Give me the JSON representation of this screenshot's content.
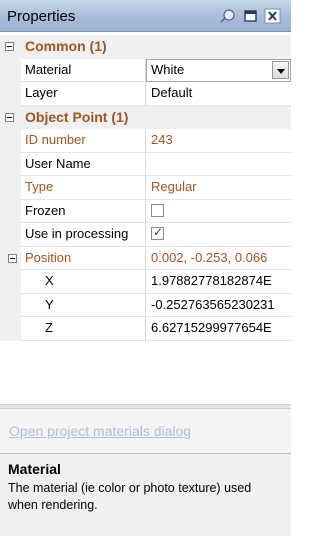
{
  "window": {
    "title": "Properties",
    "buttons": {
      "pin": "pin-icon",
      "maximize": "maximize-icon",
      "close": "close-icon"
    }
  },
  "categories": {
    "common": "Common (1)",
    "object_point": "Object Point (1)"
  },
  "properties": {
    "material": {
      "label": "Material",
      "value": "White"
    },
    "layer": {
      "label": "Layer",
      "value": "Default"
    },
    "id_number": {
      "label": "ID number",
      "value": "243"
    },
    "user_name": {
      "label": "User Name",
      "value": ""
    },
    "type": {
      "label": "Type",
      "value": "Regular"
    },
    "frozen": {
      "label": "Frozen",
      "checked": false
    },
    "use_in_processing": {
      "label": "Use in processing",
      "checked": true
    },
    "position": {
      "label": "Position",
      "value": "0.002, -0.253, 0.066",
      "x": {
        "label": "X",
        "value": "1.97882778182874E"
      },
      "y": {
        "label": "Y",
        "value": "-0.252763565230231"
      },
      "z": {
        "label": "Z",
        "value": "6.62715299977654E"
      }
    }
  },
  "link": "Open project materials dialog",
  "help": {
    "title": "Material",
    "description": "The material (ie color or photo texture) used when rendering."
  },
  "colors": {
    "category_text": "#a0541e",
    "link": "#a9bfd9",
    "titlebar": "#a7bcd9"
  }
}
